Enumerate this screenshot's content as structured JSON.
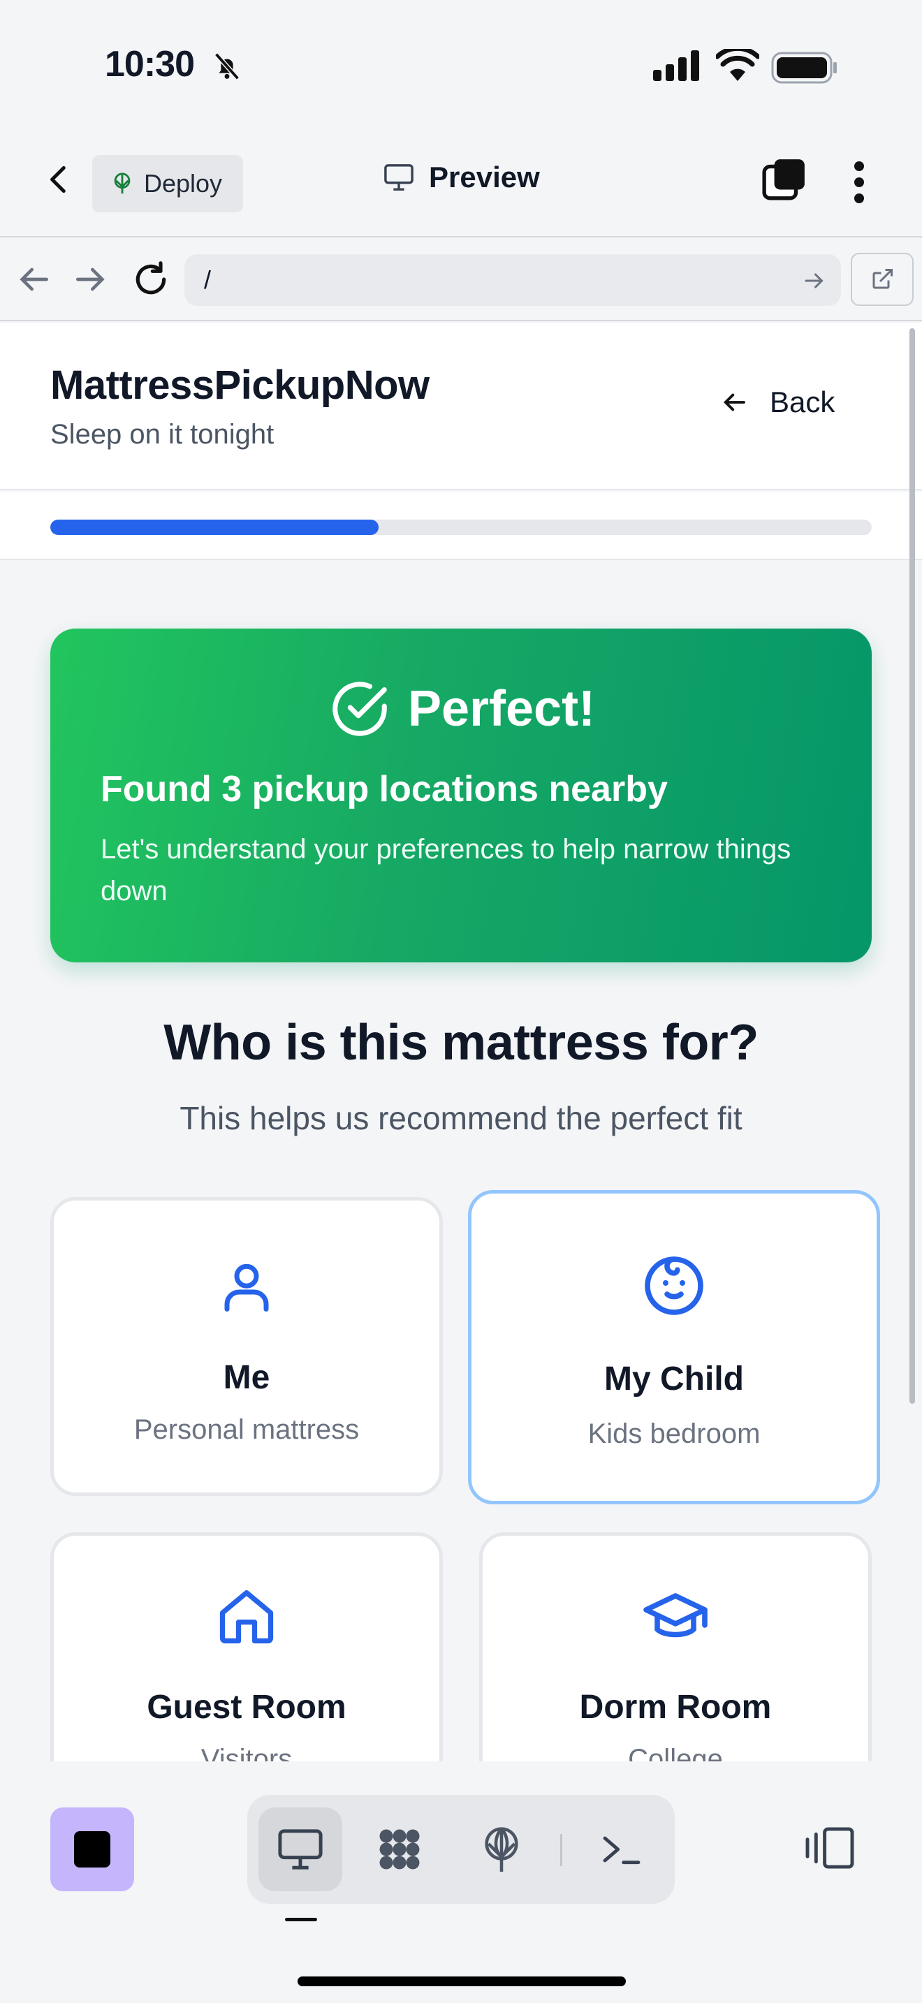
{
  "status_bar": {
    "time": "10:30",
    "icons": [
      "bell-slash-icon",
      "cellular-signal-icon",
      "wifi-icon",
      "battery-icon"
    ]
  },
  "toolbar": {
    "back_icon": "chevron-left-icon",
    "deploy_label": "Deploy",
    "preview_label": "Preview",
    "tabs_icon": "tabs-icon",
    "more_icon": "more-vertical-icon"
  },
  "browser": {
    "url": "/",
    "icons": [
      "arrow-left-icon",
      "arrow-right-icon",
      "reload-icon",
      "open-external-icon"
    ]
  },
  "site": {
    "title": "MattressPickupNow",
    "tagline": "Sleep on it tonight",
    "back_label": "Back",
    "progress_fraction": 0.4
  },
  "success": {
    "heading": "Perfect!",
    "title": "Found 3 pickup locations nearby",
    "body": "Let's understand your preferences to help narrow things down"
  },
  "question": {
    "title": "Who is this mattress for?",
    "subtitle": "This helps us recommend the perfect fit"
  },
  "options": [
    {
      "label": "Me",
      "sub": "Personal mattress",
      "icon": "user-icon",
      "selected": false
    },
    {
      "label": "My Child",
      "sub": "Kids bedroom",
      "icon": "baby-face-icon",
      "selected": true
    },
    {
      "label": "Guest Room",
      "sub": "Visitors",
      "icon": "home-icon",
      "selected": false
    },
    {
      "label": "Dorm Room",
      "sub": "College",
      "icon": "graduation-cap-icon",
      "selected": false
    }
  ],
  "dock": {
    "items": [
      "desktop-icon",
      "apps-grid-icon",
      "deploy-icon",
      "terminal-icon"
    ],
    "active": "desktop-icon"
  },
  "colors": {
    "accent": "#2563eb",
    "success_start": "#22c55e",
    "success_end": "#059669",
    "selected_border": "#93c5fd"
  }
}
